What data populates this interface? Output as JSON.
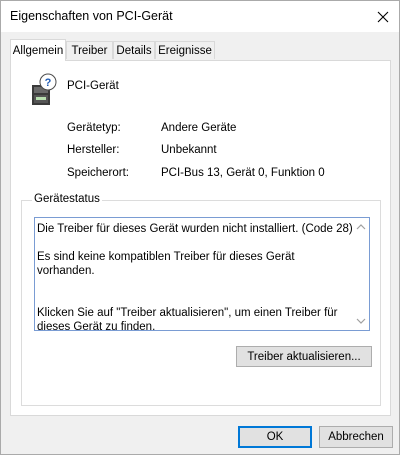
{
  "window": {
    "title": "Eigenschaften von PCI-Gerät",
    "close_icon": "close-icon"
  },
  "tabs": [
    {
      "label": "Allgemein",
      "active": true
    },
    {
      "label": "Treiber",
      "active": false
    },
    {
      "label": "Details",
      "active": false
    },
    {
      "label": "Ereignisse",
      "active": false
    }
  ],
  "device": {
    "icon": "unknown-device-icon",
    "name": "PCI-Gerät",
    "properties": [
      {
        "label": "Gerätetyp:",
        "value": "Andere Geräte"
      },
      {
        "label": "Hersteller:",
        "value": "Unbekannt"
      },
      {
        "label": "Speicherort:",
        "value": "PCI-Bus 13, Gerät 0, Funktion 0"
      }
    ]
  },
  "status": {
    "group_title": "Gerätestatus",
    "paragraphs": [
      "Die Treiber für dieses Gerät wurden nicht installiert. (Code 28)",
      "Es sind keine kompatiblen Treiber für dieses Gerät vorhanden.",
      "Klicken Sie auf \"Treiber aktualisieren\", um einen Treiber für dieses Gerät zu finden."
    ],
    "update_button": "Treiber aktualisieren..."
  },
  "footer": {
    "ok": "OK",
    "cancel": "Abbrechen"
  }
}
